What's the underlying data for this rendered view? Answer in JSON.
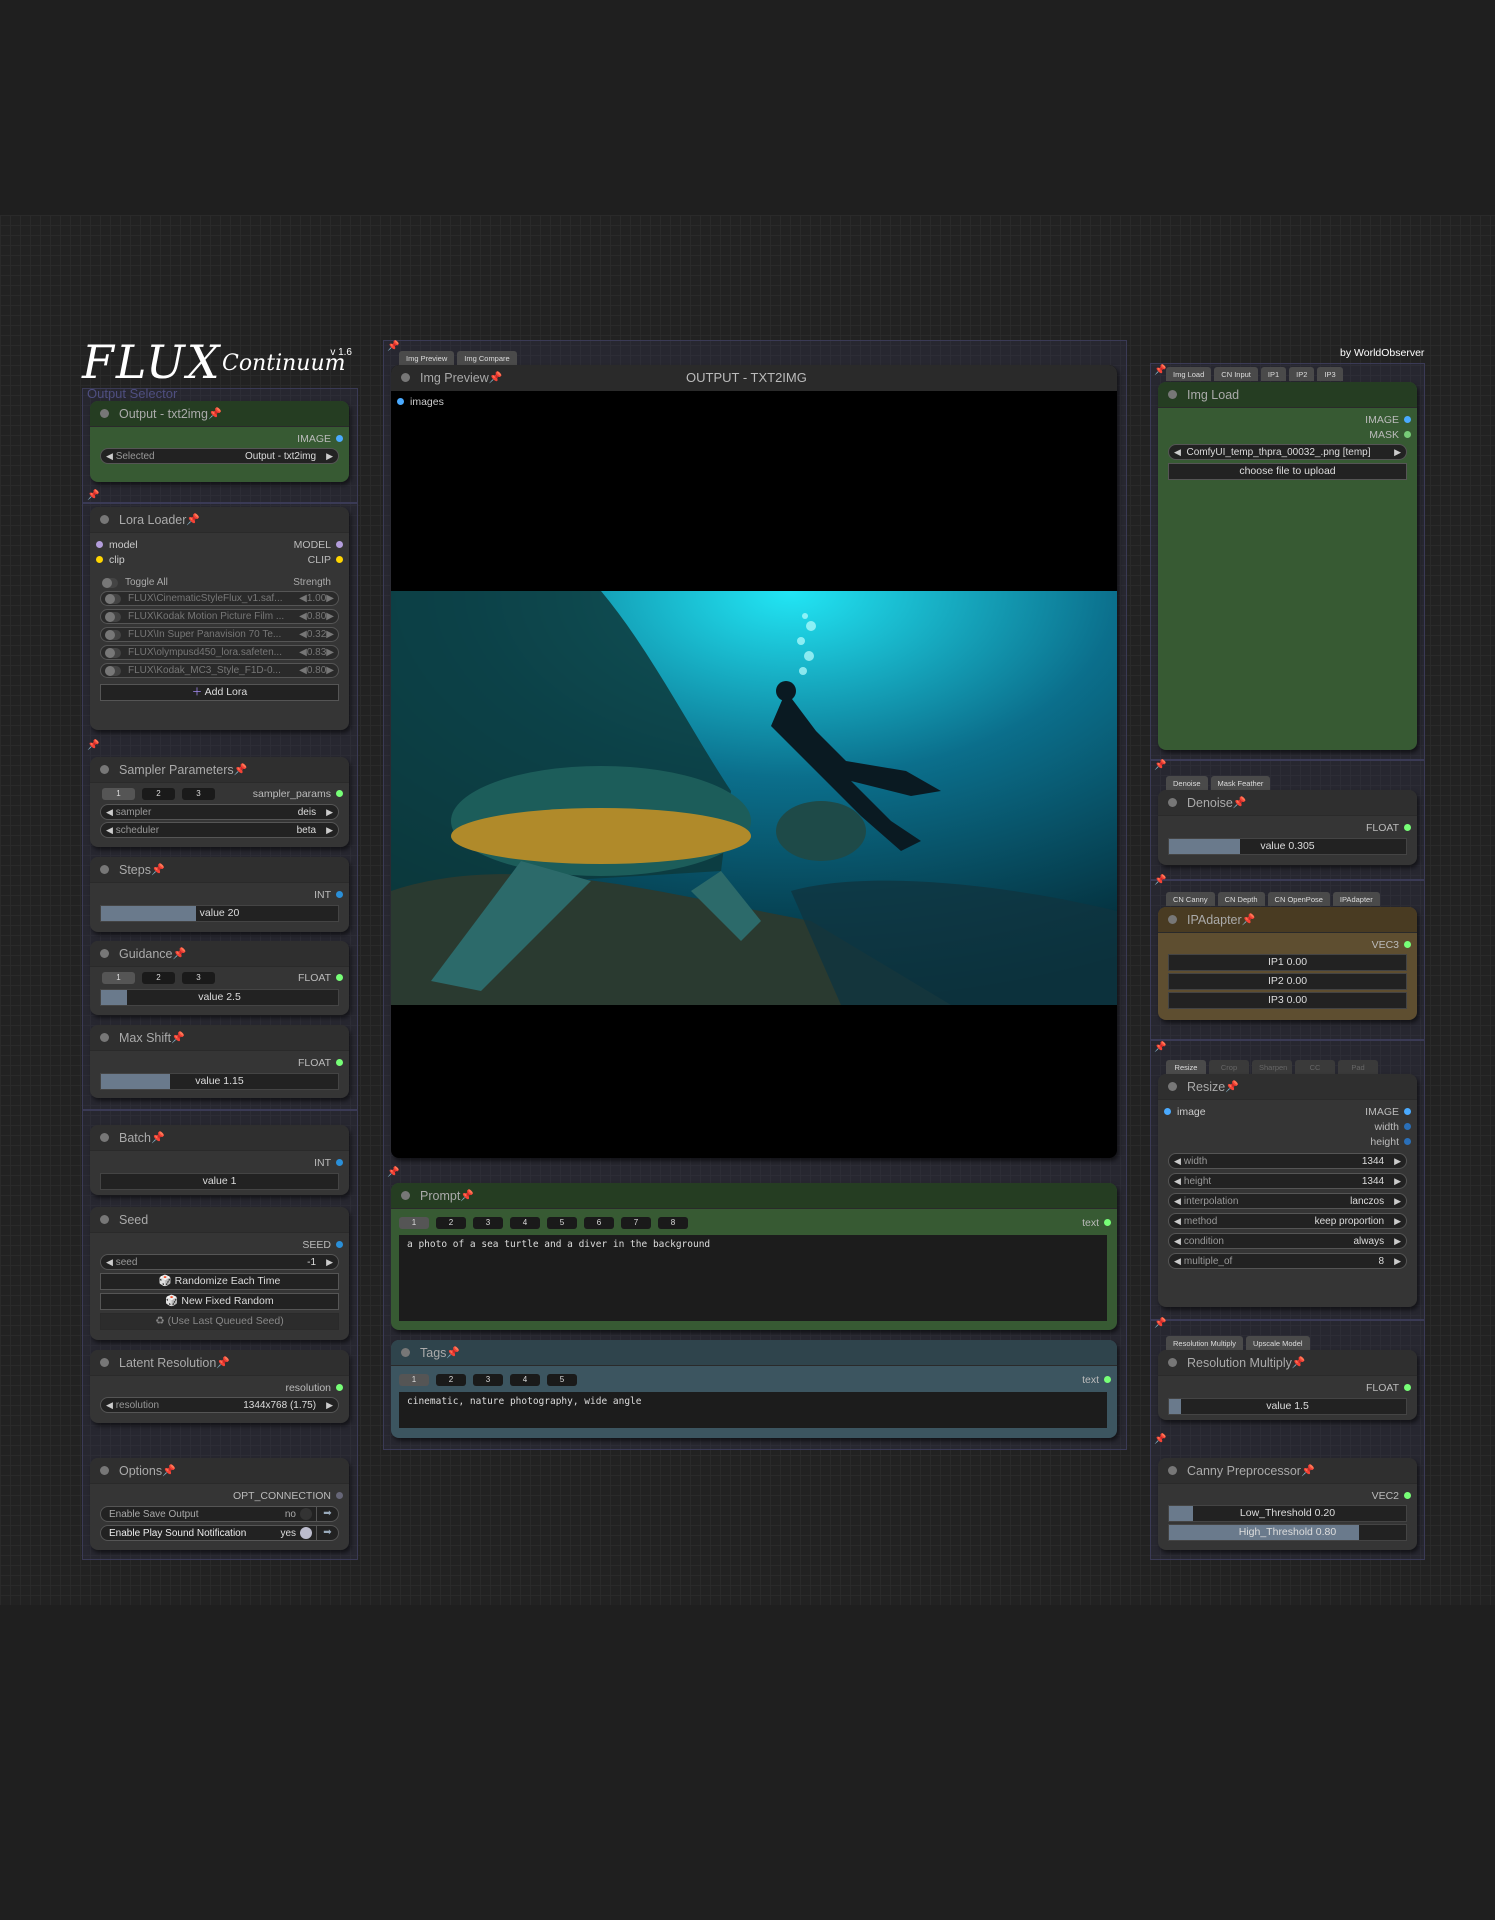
{
  "logo": {
    "title": "FLUX",
    "subtitle": "Continuum",
    "version": "v 1.6"
  },
  "credit": "by WorldObserver",
  "left": {
    "output": {
      "title": "Output - txt2img",
      "out": "IMAGE",
      "label": "Selected",
      "value": "Output - txt2img",
      "group_label": "Output Selector"
    },
    "lora": {
      "title": "Lora Loader",
      "in": [
        "model",
        "clip"
      ],
      "out": [
        "MODEL",
        "CLIP"
      ],
      "toggle_all": "Toggle All",
      "strength": "Strength",
      "items": [
        {
          "name": "FLUX\\CinematicStyleFlux_v1.saf...",
          "value": "1.00"
        },
        {
          "name": "FLUX\\Kodak Motion Picture Film ...",
          "value": "0.80"
        },
        {
          "name": "FLUX\\In Super Panavision 70 Te...",
          "value": "0.32"
        },
        {
          "name": "FLUX\\olympusd450_lora.safeten...",
          "value": "0.83"
        },
        {
          "name": "FLUX\\Kodak_MC3_Style_F1D-0...",
          "value": "0.80"
        }
      ],
      "add": "Add Lora"
    },
    "sampler": {
      "title": "Sampler Parameters",
      "tabs": [
        "1",
        "2",
        "3"
      ],
      "out": "sampler_params",
      "sampler_label": "sampler",
      "sampler": "deis",
      "scheduler_label": "scheduler",
      "scheduler": "beta"
    },
    "steps": {
      "title": "Steps",
      "out": "INT",
      "text": "value  20",
      "fill": 0.4
    },
    "guidance": {
      "title": "Guidance",
      "tabs": [
        "1",
        "2",
        "3"
      ],
      "out": "FLOAT",
      "text": "value  2.5",
      "fill": 0.11
    },
    "maxshift": {
      "title": "Max Shift",
      "out": "FLOAT",
      "text": "value  1.15",
      "fill": 0.29
    },
    "batch": {
      "title": "Batch",
      "out": "INT",
      "text": "value  1"
    },
    "seed": {
      "title": "Seed",
      "out": "SEED",
      "label": "seed",
      "value": "-1",
      "randomize": "🎲 Randomize Each Time",
      "fixed": "🎲 New Fixed Random",
      "last": "♻ (Use Last Queued Seed)"
    },
    "latent": {
      "title": "Latent Resolution",
      "out": "resolution",
      "label": "resolution",
      "value": "1344x768 (1.75)"
    },
    "options": {
      "title": "Options",
      "out": "OPT_CONNECTION",
      "save": "Enable Save Output",
      "save_v": "no",
      "sound": "Enable Play Sound Notification",
      "sound_v": "yes"
    }
  },
  "center": {
    "tabs": [
      "Img Preview",
      "Img Compare"
    ],
    "preview": {
      "title": "Img Preview",
      "heading": "OUTPUT - TXT2IMG",
      "in": "images"
    },
    "prompt": {
      "title": "Prompt",
      "tabs": [
        "1",
        "2",
        "3",
        "4",
        "5",
        "6",
        "7",
        "8"
      ],
      "out": "text",
      "value": "a photo of a sea turtle and a diver in the background"
    },
    "tags": {
      "title": "Tags",
      "tabs": [
        "1",
        "2",
        "3",
        "4",
        "5"
      ],
      "out": "text",
      "value": "cinematic, nature photography, wide angle"
    }
  },
  "right": {
    "imgload": {
      "tabs": [
        "Img Load",
        "CN Input",
        "IP1",
        "IP2",
        "IP3"
      ],
      "title": "Img Load",
      "out": [
        "IMAGE",
        "MASK"
      ],
      "file": "ComfyUI_temp_thpra_00032_.png [temp]",
      "upload": "choose file to upload"
    },
    "denoise": {
      "tabs": [
        "Denoise",
        "Mask Feather"
      ],
      "title": "Denoise",
      "out": "FLOAT",
      "text": "value  0.305",
      "fill": 0.3
    },
    "ipadapter": {
      "tabs": [
        "CN Canny",
        "CN Depth",
        "CN OpenPose",
        "IPAdapter"
      ],
      "title": "IPAdapter",
      "out": "VEC3",
      "values": [
        "IP1  0.00",
        "IP2  0.00",
        "IP3  0.00"
      ]
    },
    "resize": {
      "tabs": [
        "Resize",
        "Crop",
        "Sharpen",
        "CC",
        "Pad"
      ],
      "title": "Resize",
      "in": "image",
      "out": [
        "IMAGE",
        "width",
        "height"
      ],
      "fields": [
        {
          "k": "width",
          "v": "1344"
        },
        {
          "k": "height",
          "v": "1344"
        },
        {
          "k": "interpolation",
          "v": "lanczos"
        },
        {
          "k": "method",
          "v": "keep proportion"
        },
        {
          "k": "condition",
          "v": "always"
        },
        {
          "k": "multiple_of",
          "v": "8"
        }
      ]
    },
    "resmult": {
      "tabs": [
        "Resolution Multiply",
        "Upscale Model"
      ],
      "title": "Resolution Multiply",
      "out": "FLOAT",
      "text": "value  1.5",
      "fill": 0.05
    },
    "canny": {
      "title": "Canny Preprocessor",
      "out": "VEC2",
      "low": "Low_Threshold  0.20",
      "low_fill": 0.1,
      "high": "High_Threshold  0.80",
      "high_fill": 0.8
    }
  },
  "colors": {
    "green_node": "#2f4a2c",
    "brown_node": "#5e4e30",
    "teal_node": "#3a4a52",
    "pin": "#e8406a"
  }
}
